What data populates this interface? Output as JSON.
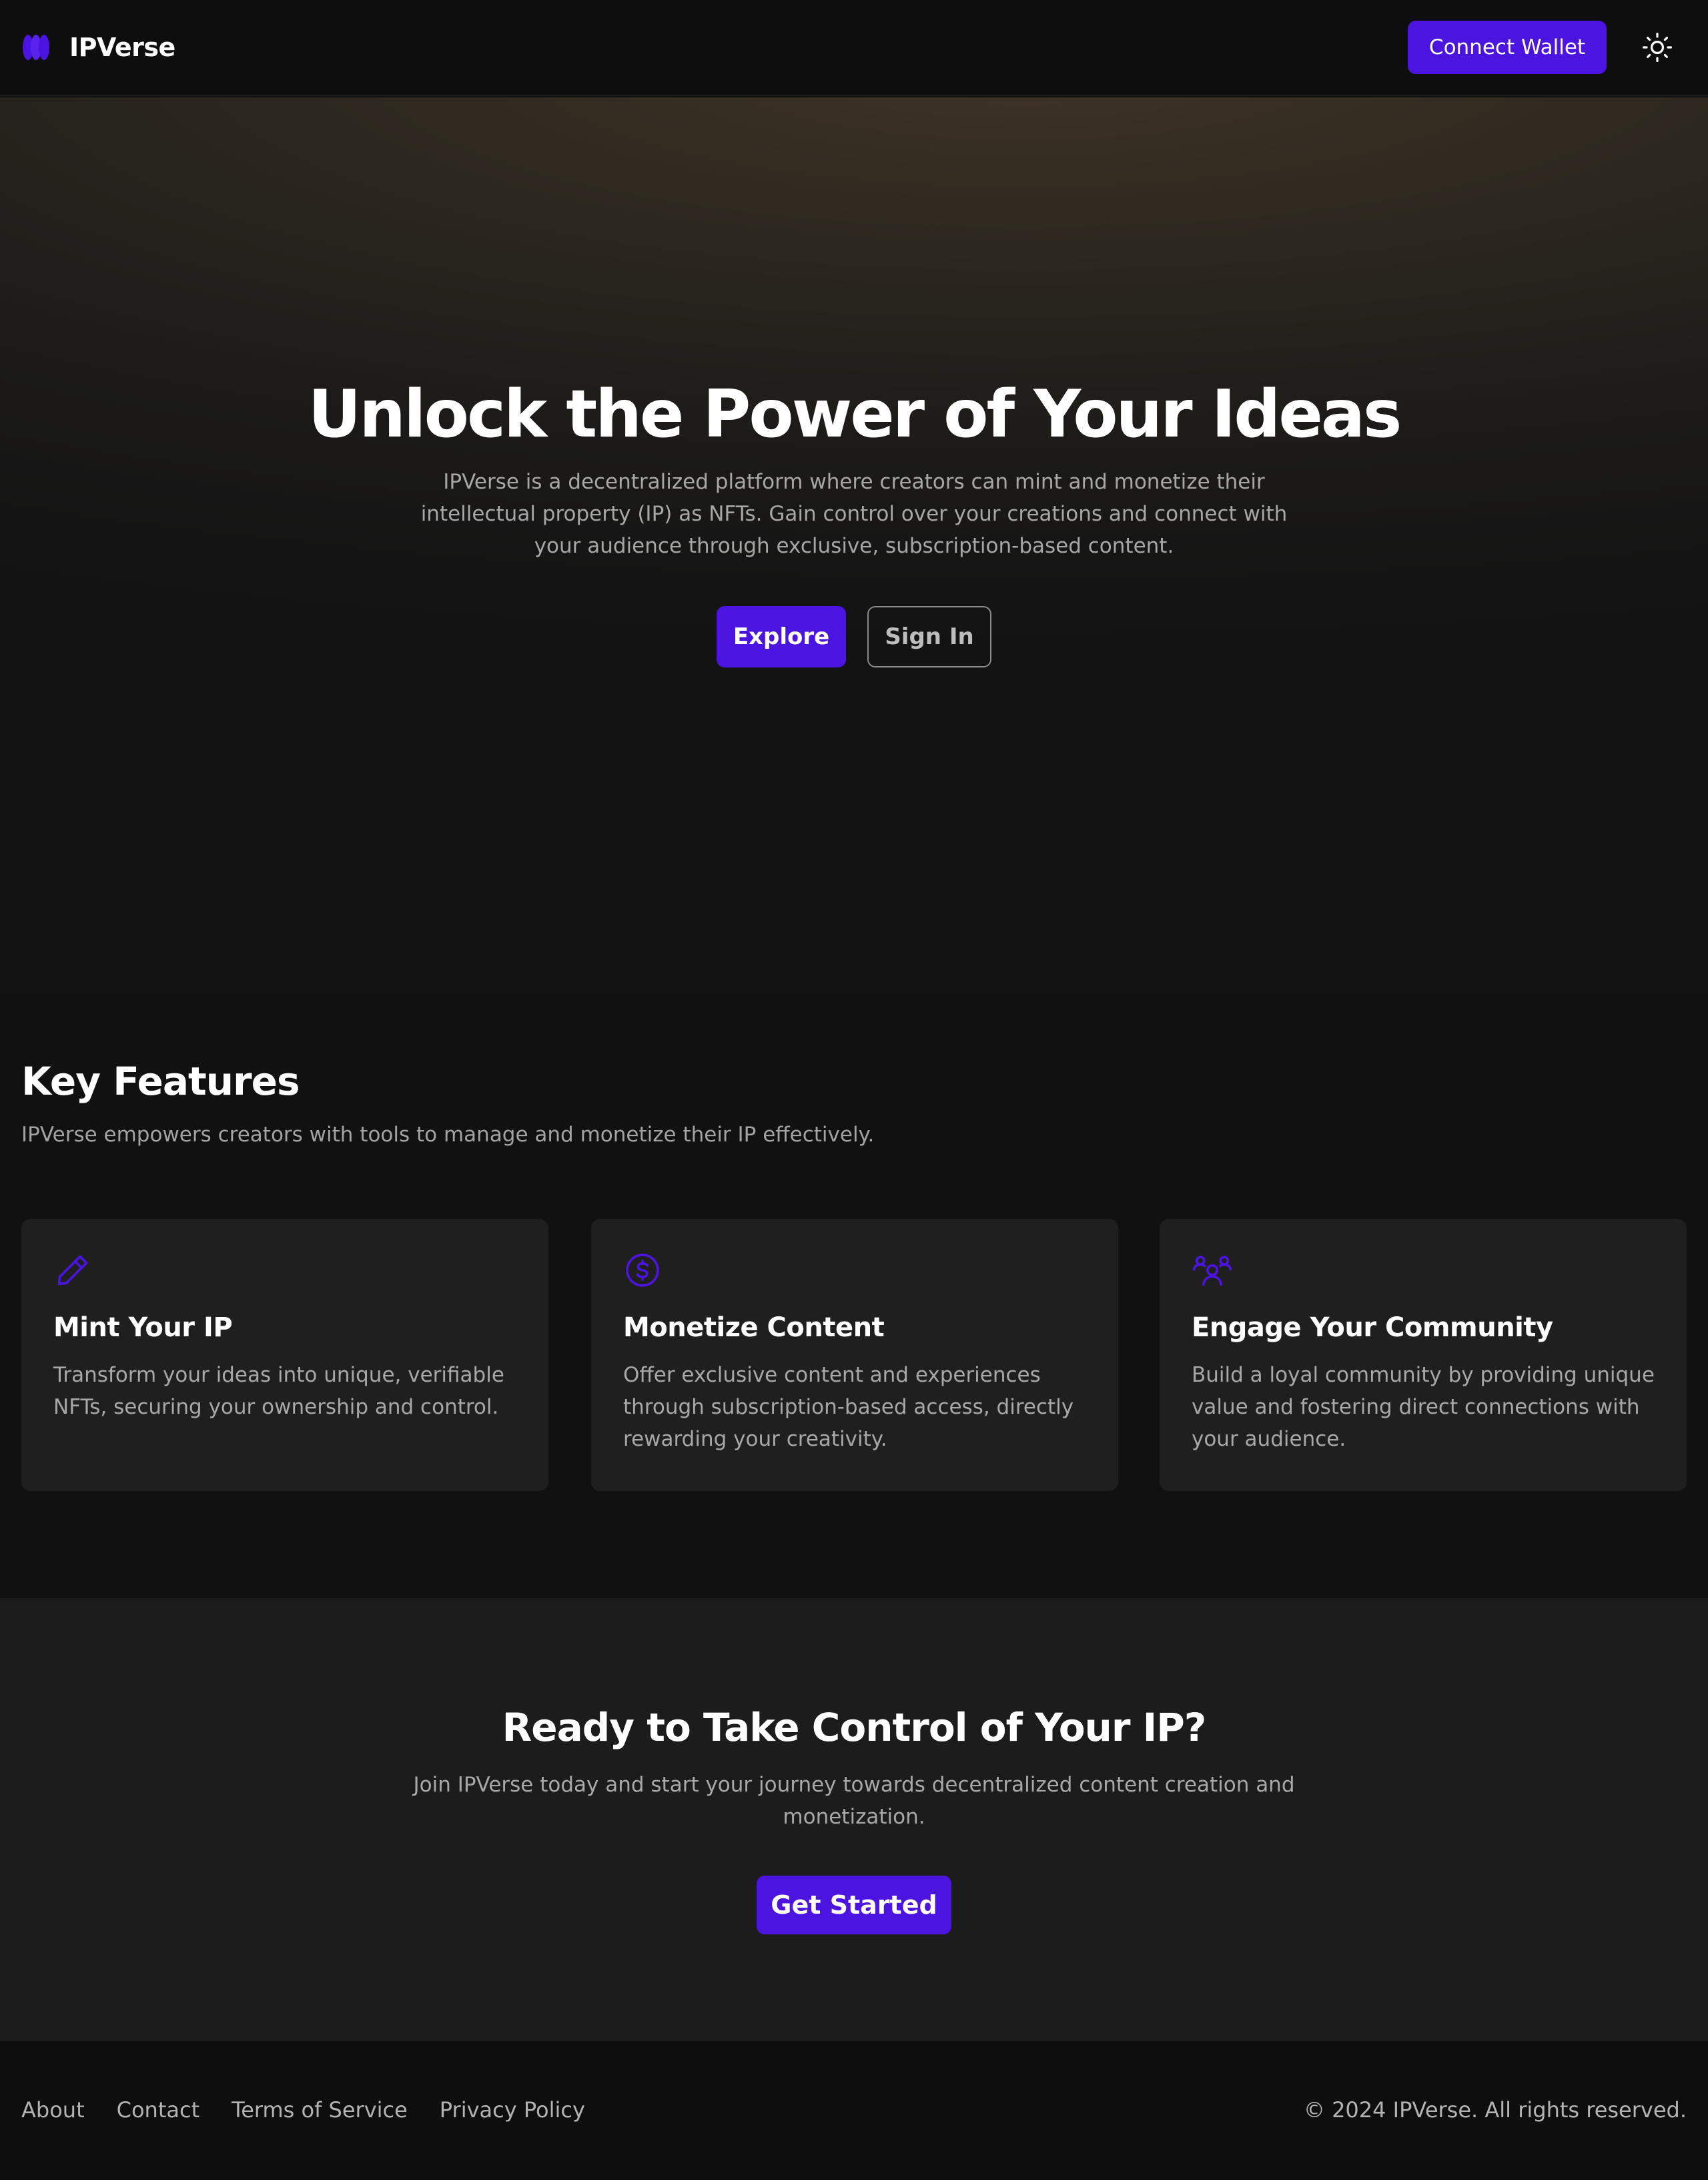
{
  "header": {
    "brand": "IPVerse",
    "connect_wallet_label": "Connect Wallet",
    "theme_toggle_icon": "sun-icon"
  },
  "hero": {
    "title": "Unlock the Power of Your Ideas",
    "description": "IPVerse is a decentralized platform where creators can mint and monetize their intellectual property (IP) as NFTs. Gain control over your creations and connect with your audience through exclusive, subscription-based content.",
    "explore_label": "Explore",
    "signin_label": "Sign In"
  },
  "features": {
    "title": "Key Features",
    "subtitle": "IPVerse empowers creators with tools to manage and monetize their IP effectively.",
    "cards": [
      {
        "icon": "pencil-icon",
        "title": "Mint Your IP",
        "text": "Transform your ideas into unique, verifiable NFTs, securing your ownership and control."
      },
      {
        "icon": "dollar-circle-icon",
        "title": "Monetize Content",
        "text": "Offer exclusive content and experiences through subscription-based access, directly rewarding your creativity."
      },
      {
        "icon": "community-icon",
        "title": "Engage Your Community",
        "text": "Build a loyal community by providing unique value and fostering direct connections with your audience."
      }
    ]
  },
  "cta": {
    "title": "Ready to Take Control of Your IP?",
    "description": "Join IPVerse today and start your journey towards decentralized content creation and monetization.",
    "button_label": "Get Started"
  },
  "footer": {
    "links": [
      "About",
      "Contact",
      "Terms of Service",
      "Privacy Policy"
    ],
    "copyright": "© 2024 IPVerse. All rights reserved."
  },
  "colors": {
    "accent": "#4c14e0",
    "background": "#111111",
    "card": "#1f1f1f",
    "muted_text": "#a8a8a8"
  }
}
